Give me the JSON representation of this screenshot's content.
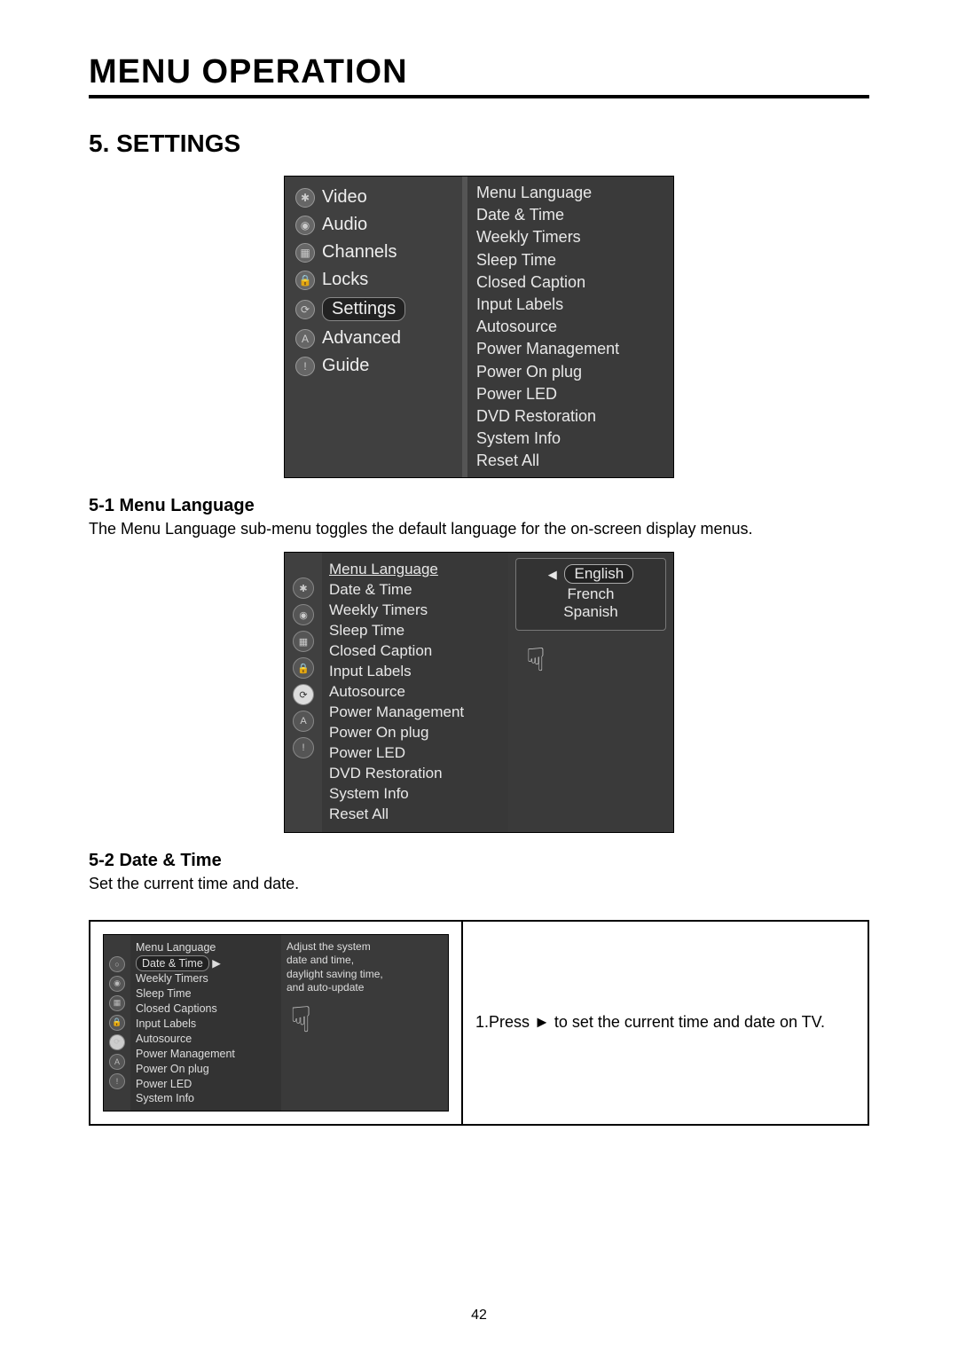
{
  "page": {
    "title": "MENU OPERATION",
    "section_title": "5. SETTINGS",
    "sub1_title": "5-1  Menu Language",
    "sub1_desc": "The Menu Language sub-menu toggles the default language for the on-screen display menus.",
    "sub2_title": "5-2  Date & Time",
    "sub2_desc": "Set the current time and date.",
    "page_number": "42"
  },
  "osd1": {
    "left_items": [
      {
        "icon": "✱",
        "label": "Video"
      },
      {
        "icon": "◉",
        "label": "Audio"
      },
      {
        "icon": "▦",
        "label": "Channels"
      },
      {
        "icon": "🔒",
        "label": "Locks"
      },
      {
        "icon": "⟳",
        "label": "Settings",
        "selected": true
      },
      {
        "icon": "A",
        "label": "Advanced"
      },
      {
        "icon": "!",
        "label": "Guide"
      }
    ],
    "right_items": [
      "Menu Language",
      "Date & Time",
      "Weekly Timers",
      "Sleep Time",
      "Closed Caption",
      "Input Labels",
      "Autosource",
      "Power Management",
      "Power On plug",
      "Power LED",
      "DVD Restoration",
      "System Info",
      "Reset All"
    ]
  },
  "osd2": {
    "mid_items": [
      "Menu Language",
      "Date & Time",
      "Weekly Timers",
      "Sleep Time",
      "Closed Caption",
      "Input Labels",
      "Autosource",
      "Power Management",
      "Power On plug",
      "Power LED",
      "DVD Restoration",
      "System Info",
      "Reset All"
    ],
    "languages": {
      "selected": "English",
      "opt2": "French",
      "opt3": "Spanish"
    }
  },
  "osd3": {
    "mid_items": [
      "Menu Language",
      "Date & Time",
      "Weekly Timers",
      "Sleep Time",
      "Closed Captions",
      "Input Labels",
      "Autosource",
      "Power Management",
      "Power On plug",
      "Power LED",
      "System Info"
    ],
    "help_l1": "Adjust the system",
    "help_l2": "date and time,",
    "help_l3": "daylight saving time,",
    "help_l4": "and auto-update",
    "instruction": "1.Press ► to set the current time and date on TV."
  }
}
